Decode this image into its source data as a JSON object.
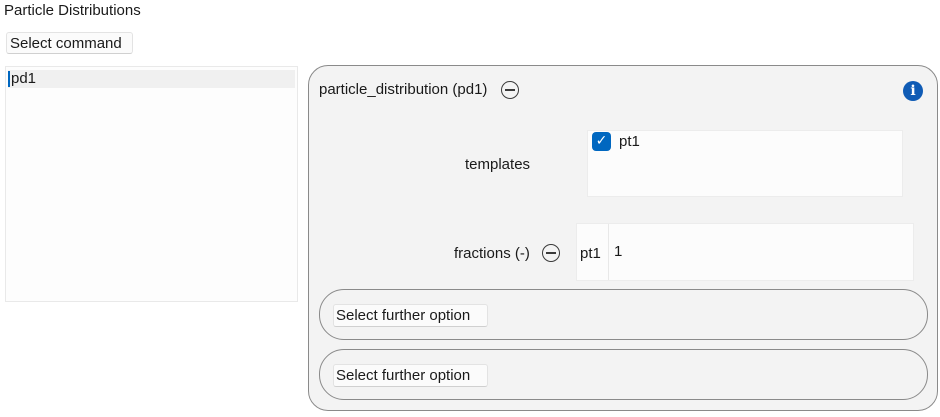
{
  "header": {
    "title": "Particle Distributions"
  },
  "command": {
    "select_label": "Select command"
  },
  "list": {
    "items": [
      {
        "label": "pd1"
      }
    ]
  },
  "panel": {
    "title": "particle_distribution (pd1)",
    "templates": {
      "label": "templates",
      "items": [
        {
          "label": "pt1",
          "checked": true
        }
      ]
    },
    "fractions": {
      "label": "fractions (-)",
      "rows": [
        {
          "name": "pt1",
          "value": "1"
        }
      ]
    },
    "options": [
      {
        "label": "Select further option"
      },
      {
        "label": "Select further option"
      }
    ]
  },
  "colors": {
    "accent": "#0067c0",
    "info": "#0f5bb5",
    "panel_bg": "#f3f3f3",
    "border": "#8a8a8a"
  },
  "icons": {
    "collapse": "minus-circle-icon",
    "info": "info-icon",
    "check": "checkmark-icon"
  }
}
